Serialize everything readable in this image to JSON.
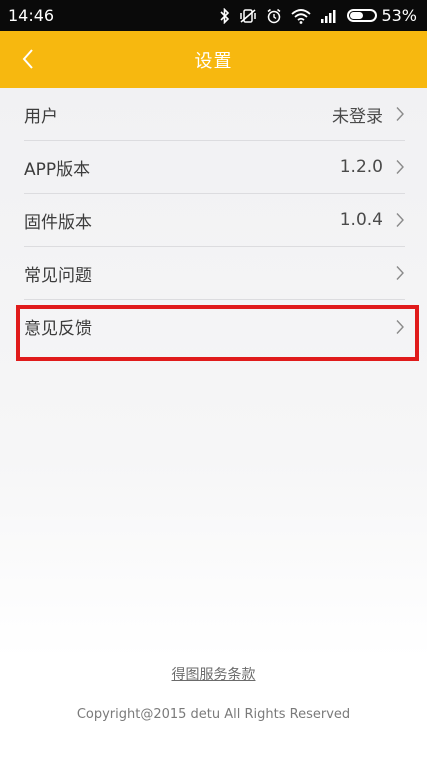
{
  "status_bar": {
    "time": "14:46",
    "battery_percent_text": "53%",
    "battery_level": 0.53,
    "icons": [
      "bluetooth-icon",
      "vibrate-icon",
      "alarm-icon",
      "wifi-icon",
      "signal-icon",
      "battery-icon"
    ]
  },
  "header": {
    "title": "设置",
    "background_color": "#f7b80f",
    "back_icon": "chevron-left-icon"
  },
  "settings": {
    "items": [
      {
        "label": "用户",
        "value": "未登录"
      },
      {
        "label": "APP版本",
        "value": "1.2.0"
      },
      {
        "label": "固件版本",
        "value": "1.0.4"
      },
      {
        "label": "常见问题",
        "value": ""
      },
      {
        "label": "意见反馈",
        "value": ""
      }
    ],
    "highlighted_item_color": "#e01b1b"
  },
  "footer": {
    "terms_link": "得图服务条款",
    "copyright": "Copyright@2015 detu All Rights Reserved"
  }
}
